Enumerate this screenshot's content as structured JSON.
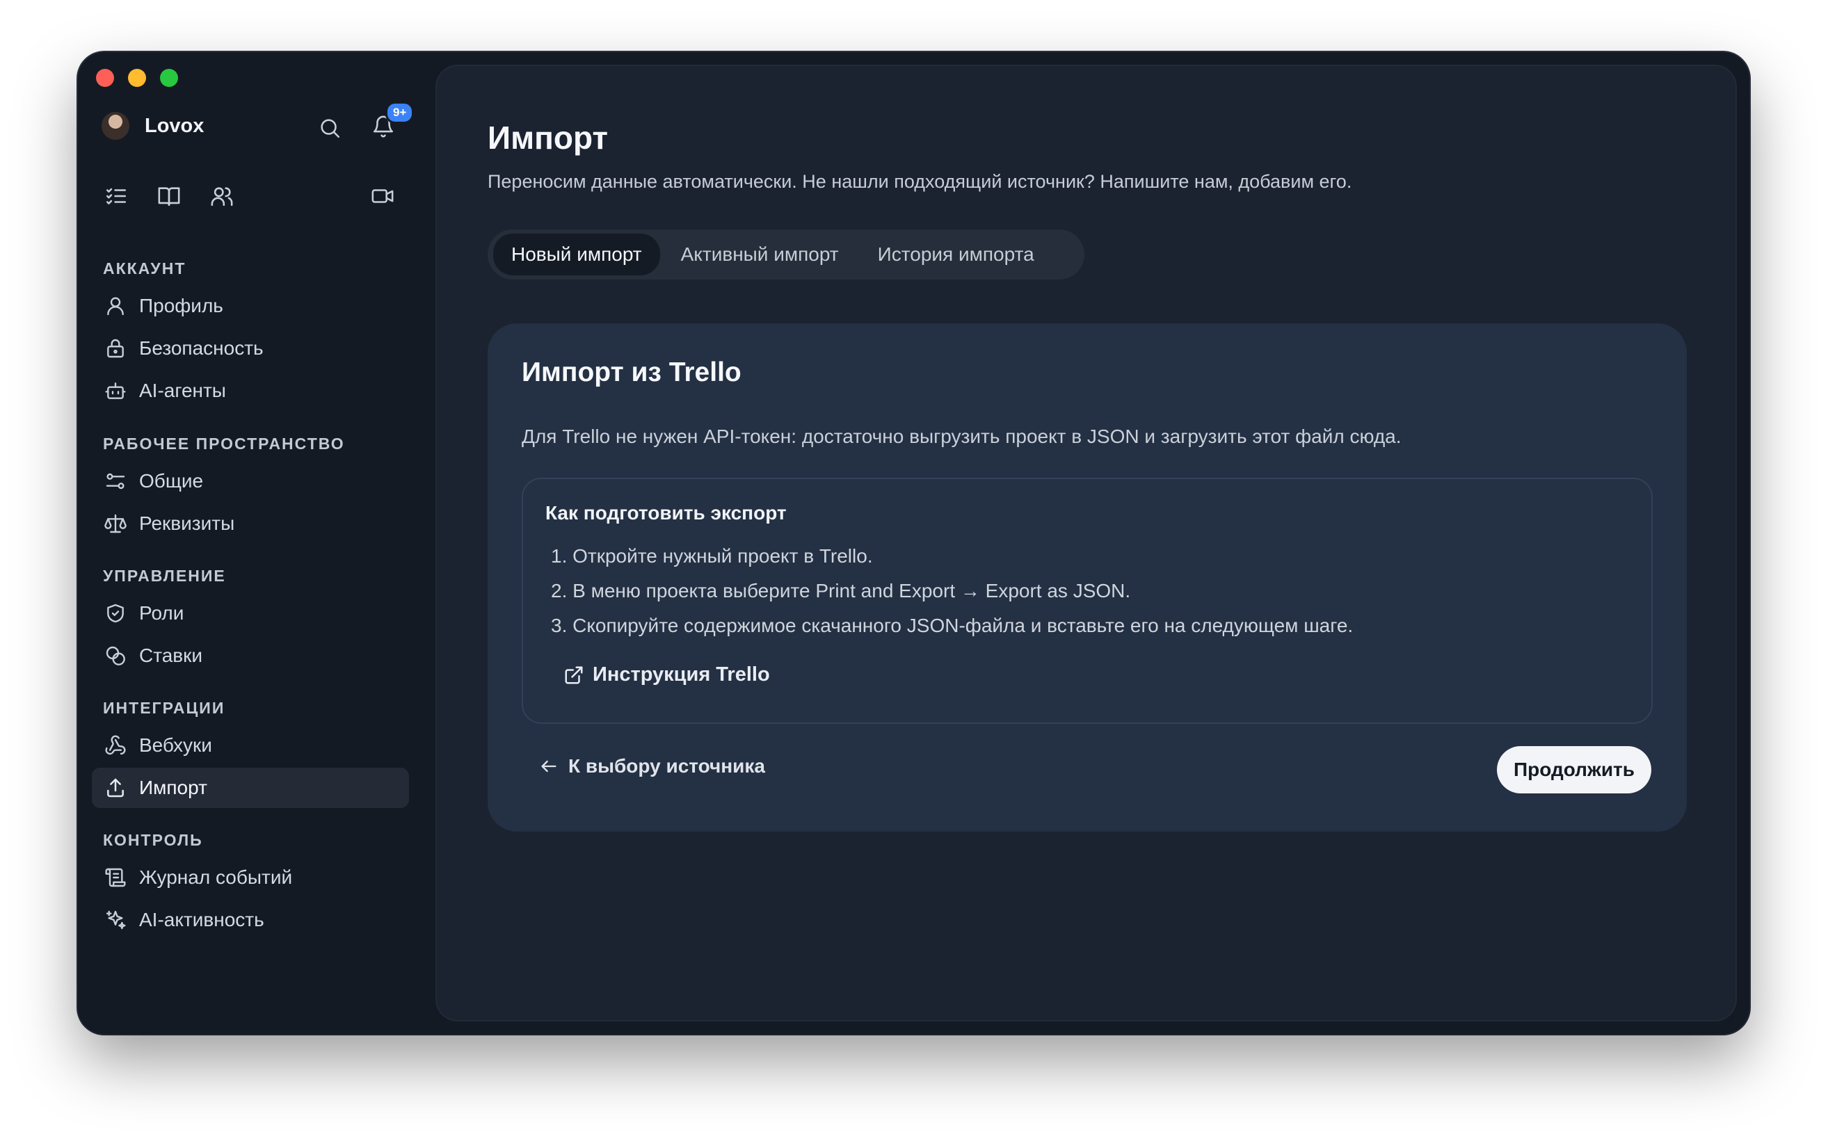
{
  "app": {
    "user_name": "Lovox",
    "notification_badge": "9+"
  },
  "sidebar": {
    "sections": [
      {
        "title": "АККАУНТ",
        "items": [
          {
            "label": "Профиль",
            "icon": "user-icon"
          },
          {
            "label": "Безопасность",
            "icon": "lock-icon"
          },
          {
            "label": "AI-агенты",
            "icon": "robot-icon"
          }
        ]
      },
      {
        "title": "РАБОЧЕЕ ПРОСТРАНСТВО",
        "items": [
          {
            "label": "Общие",
            "icon": "sliders-icon"
          },
          {
            "label": "Реквизиты",
            "icon": "scale-icon"
          }
        ]
      },
      {
        "title": "УПРАВЛЕНИЕ",
        "items": [
          {
            "label": "Роли",
            "icon": "shield-icon"
          },
          {
            "label": "Ставки",
            "icon": "coins-icon"
          }
        ]
      },
      {
        "title": "ИНТЕГРАЦИИ",
        "items": [
          {
            "label": "Вебхуки",
            "icon": "webhook-icon"
          },
          {
            "label": "Импорт",
            "icon": "upload-icon",
            "active": true
          }
        ]
      },
      {
        "title": "КОНТРОЛЬ",
        "items": [
          {
            "label": "Журнал событий",
            "icon": "scroll-icon"
          },
          {
            "label": "AI-активность",
            "icon": "sparkles-icon"
          }
        ]
      }
    ]
  },
  "main": {
    "title": "Импорт",
    "subtitle": "Переносим данные автоматически. Не нашли подходящий источник? Напишите нам, добавим его.",
    "tabs": [
      {
        "label": "Новый импорт",
        "active": true
      },
      {
        "label": "Активный импорт"
      },
      {
        "label": "История импорта"
      }
    ],
    "card": {
      "title": "Импорт из Trello",
      "description": "Для Trello не нужен API-токен: достаточно выгрузить проект в JSON и загрузить этот файл сюда.",
      "instructions": {
        "title": "Как подготовить экспорт",
        "steps": [
          "1. Откройте нужный проект в Trello.",
          "2. В меню проекта выберите Print and Export → Export as JSON.",
          "3. Скопируйте содержимое скачанного JSON-файла и вставьте его на следующем шаге."
        ],
        "link_label": "Инструкция Trello"
      },
      "back_label": "К выбору источника",
      "continue_label": "Продолжить"
    }
  },
  "colors": {
    "window_bg": "#141a24",
    "panel_bg": "#1b2230",
    "card_bg": "#243043",
    "active_item_bg": "#242b37",
    "badge": "#3b82f6",
    "primary_button": "#f2f4f7"
  }
}
